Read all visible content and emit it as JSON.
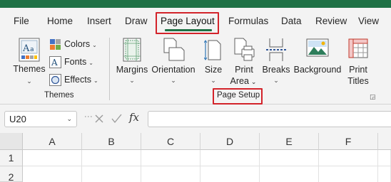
{
  "tabs": [
    {
      "label": "File"
    },
    {
      "label": "Home"
    },
    {
      "label": "Insert"
    },
    {
      "label": "Draw"
    },
    {
      "label": "Page Layout"
    },
    {
      "label": "Formulas"
    },
    {
      "label": "Data"
    },
    {
      "label": "Review"
    },
    {
      "label": "View"
    }
  ],
  "active_tab": "Page Layout",
  "ribbon": {
    "themes_group": {
      "themes_label": "Themes",
      "colors_label": "Colors",
      "fonts_label": "Fonts",
      "effects_label": "Effects",
      "group_label": "Themes"
    },
    "page_setup_group": {
      "margins_label": "Margins",
      "orientation_label": "Orientation",
      "size_label": "Size",
      "print_area_label_1": "Print",
      "print_area_label_2": "Area",
      "breaks_label": "Breaks",
      "background_label": "Background",
      "print_titles_label_1": "Print",
      "print_titles_label_2": "Titles",
      "group_label": "Page Setup"
    }
  },
  "formula_bar": {
    "name_box_value": "U20",
    "formula_value": "",
    "fx_label": "fx"
  },
  "grid": {
    "columns": [
      "A",
      "B",
      "C",
      "D",
      "E",
      "F"
    ],
    "rows": [
      "1",
      "2"
    ]
  },
  "colors": {
    "accent_green": "#1e7145",
    "highlight_red": "#d3232a",
    "ribbon_bg": "#f3f3f3"
  }
}
